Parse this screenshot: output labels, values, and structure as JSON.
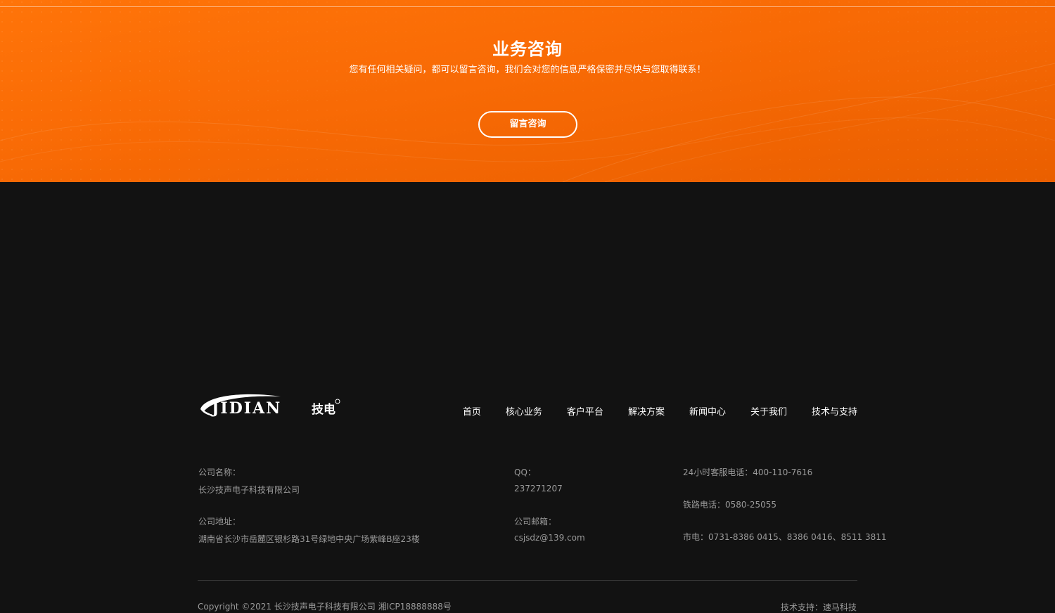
{
  "consult": {
    "title": "业务咨询",
    "subtitle": "您有任何相关疑问，都可以留言咨询，我们会对您的信息严格保密并尽快与您取得联系！",
    "button_label": "留言咨询",
    "bg_color": "#f86a05"
  },
  "footer": {
    "logo_text": "JIDIAN",
    "logo_cn": "技电",
    "nav": [
      "首页",
      "核心业务",
      "客户平台",
      "解决方案",
      "新闻中心",
      "关于我们",
      "技术与支持"
    ],
    "company_name_label": "公司名称：",
    "company_name": "长沙技声电子科技有限公司",
    "address_label": "公司地址：",
    "address": "湖南省长沙市岳麓区银杉路31号绿地中央广场紫峰B座23楼",
    "qq_label": "QQ：",
    "qq": "237271207",
    "email_label": "公司邮箱：",
    "email": "csjsdz@139.com",
    "hotline": "24小时客服电话：400-110-7616",
    "railway_phone": "铁路电话：0580-25055",
    "city_phone": "市电：0731-8386 0415、8386 0416、8511 3811",
    "copyright": "Copyright ©2021 长沙技声电子科技有限公司 湘ICP18888888号",
    "support_label": "技术支持：",
    "support_name": "速马科技",
    "bg_color": "#121212"
  }
}
